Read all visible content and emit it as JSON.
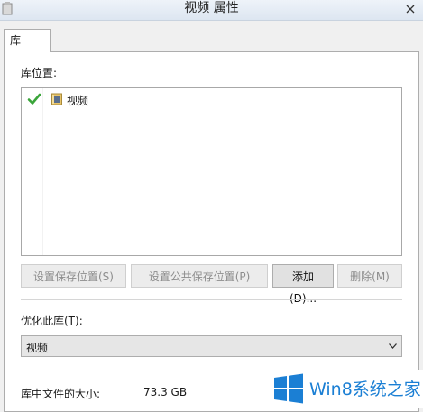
{
  "window": {
    "title": "视频 属性"
  },
  "tabs": [
    {
      "label": "库"
    }
  ],
  "library_locations": {
    "label": "库位置:",
    "items": [
      {
        "label": "视频",
        "status": "default-save-location"
      }
    ]
  },
  "buttons": {
    "set_save_location": "设置保存位置(S)",
    "set_public_save_location": "设置公共保存位置(P)",
    "add": "添加(D)...",
    "remove": "删除(M)"
  },
  "optimize": {
    "label": "优化此库(T):",
    "selected": "视频"
  },
  "size": {
    "label": "库中文件的大小:",
    "value": "73.3 GB"
  },
  "watermark": {
    "text": "Win8系统之家"
  },
  "colors": {
    "check_green": "#3aa53a",
    "watermark_blue": "#1b7fd4"
  },
  "icons": [
    "window-icon",
    "close-icon",
    "check-icon",
    "folder-icon",
    "dropdown-arrow-icon",
    "windows-logo-icon"
  ]
}
